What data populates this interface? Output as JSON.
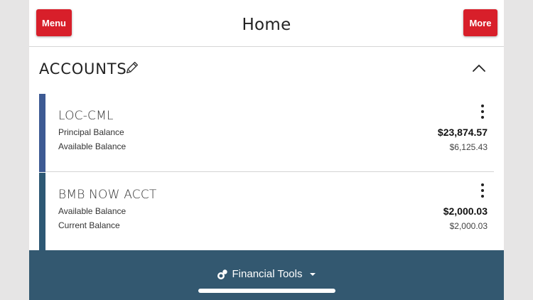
{
  "header": {
    "menu_label": "Menu",
    "more_label": "More",
    "title": "Home"
  },
  "accounts_section": {
    "title": "ACCOUNTS",
    "edit_icon": "pencil-icon",
    "collapse_icon": "chevron-up-icon"
  },
  "accounts": [
    {
      "name": "LOC-CML",
      "accent_color": "#3d5a93",
      "primary_label": "Principal Balance",
      "primary_value": "$23,874.57",
      "secondary_label": "Available Balance",
      "secondary_value": "$6,125.43"
    },
    {
      "name": "BMB NOW ACCT",
      "accent_color": "#2d5874",
      "primary_label": "Available Balance",
      "primary_value": "$2,000.03",
      "secondary_label": "Current Balance",
      "secondary_value": "$2,000.03"
    }
  ],
  "footer": {
    "label": "Financial Tools",
    "icon": "coins-icon",
    "caret_icon": "caret-down-icon",
    "background": "#335870"
  },
  "colors": {
    "brand_red": "#d81f2a"
  }
}
